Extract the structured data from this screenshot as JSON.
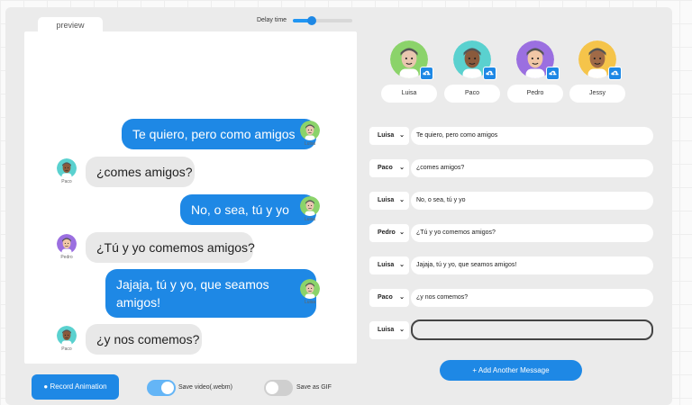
{
  "preview_tab": "preview",
  "delay": {
    "label": "Delay time",
    "value_fraction": 0.32
  },
  "characters": [
    {
      "name": "Luisa",
      "color": "#8bd36a"
    },
    {
      "name": "Paco",
      "color": "#5ad1cf"
    },
    {
      "name": "Pedro",
      "color": "#9b6fe0"
    },
    {
      "name": "Jessy",
      "color": "#f5c44a"
    }
  ],
  "chat": [
    {
      "speaker": "Luisa",
      "text": "Te quiero, pero como amigos",
      "side": "right"
    },
    {
      "speaker": "Paco",
      "text": "¿comes amigos?",
      "side": "left"
    },
    {
      "speaker": "Luisa",
      "text": "No, o sea, tú y yo",
      "side": "right"
    },
    {
      "speaker": "Pedro",
      "text": "¿Tú y yo comemos amigos?",
      "side": "left"
    },
    {
      "speaker": "Luisa",
      "text": "Jajaja, tú y yo, que seamos amigos!",
      "side": "right"
    },
    {
      "speaker": "Paco",
      "text": "¿y nos comemos?",
      "side": "left"
    }
  ],
  "editor": [
    {
      "speaker": "Luisa",
      "text": "Te quiero, pero como amigos"
    },
    {
      "speaker": "Paco",
      "text": "¿comes amigos?"
    },
    {
      "speaker": "Luisa",
      "text": "No, o sea, tú y yo"
    },
    {
      "speaker": "Pedro",
      "text": "¿Tú y yo comemos amigos?"
    },
    {
      "speaker": "Luisa",
      "text": "Jajaja, tú y yo, que seamos amigos!"
    },
    {
      "speaker": "Paco",
      "text": "¿y nos comemos?"
    },
    {
      "speaker": "Luisa",
      "text": ""
    }
  ],
  "add_message_label": "+ Add Another Message",
  "record_label": "● Record Animation",
  "save_video": {
    "label": "Save video(.webm)",
    "on": true
  },
  "save_gif": {
    "label": "Save as GIF",
    "on": false
  },
  "accent": "#1e88e5"
}
